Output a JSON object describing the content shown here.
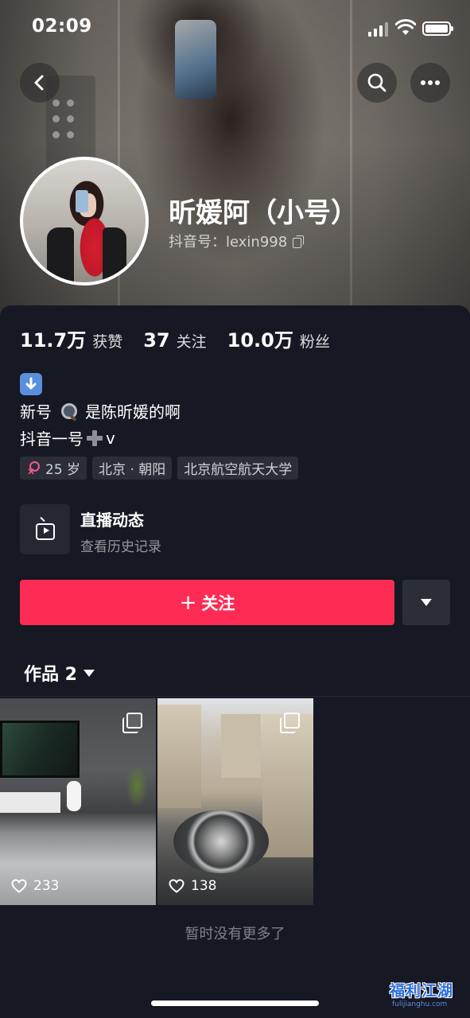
{
  "status_bar": {
    "time": "02:09",
    "icons": [
      "signal-icon",
      "wifi-icon",
      "battery-icon"
    ]
  },
  "nav": {
    "back_icon": "chevron-left-icon",
    "search_icon": "search-icon",
    "more_icon": "more-dots-icon"
  },
  "profile": {
    "nickname": "昕媛阿（小号）",
    "douyin_id": "抖音号：lexin998",
    "copy_icon": "copy-icon"
  },
  "stats": [
    {
      "value": "11.7万",
      "label": "获赞"
    },
    {
      "value": "37",
      "label": "关注"
    },
    {
      "value": "10.0万",
      "label": "粉丝"
    }
  ],
  "bio": {
    "emoji_line": "⬇️",
    "line1_before": "新号",
    "line1_after": "是陈昕媛的啊",
    "line2_before": "抖音一号",
    "line2_after": "v"
  },
  "tags": {
    "age": "25 岁",
    "location": "北京 · 朝阳",
    "school": "北京航空航天大学"
  },
  "live": {
    "title": "直播动态",
    "subtitle": "查看历史记录",
    "icon": "live-tv-icon"
  },
  "actions": {
    "follow_plus": "+",
    "follow_label": "关注",
    "dropdown_icon": "triangle-down-icon"
  },
  "works": {
    "tab_label": "作品 2",
    "items": [
      {
        "likes": "233",
        "multi_icon": "multi-image-icon"
      },
      {
        "likes": "138",
        "multi_icon": "multi-image-icon"
      }
    ],
    "no_more": "暂时没有更多了"
  },
  "watermark": {
    "main": "福利江湖",
    "url": "fulijianghu.com"
  },
  "colors": {
    "background": "#161823",
    "primary_button": "#fe2c55",
    "secondary_button": "#2b2d37",
    "tag_bg": "#2b2d37",
    "female_icon": "#f2598d"
  }
}
